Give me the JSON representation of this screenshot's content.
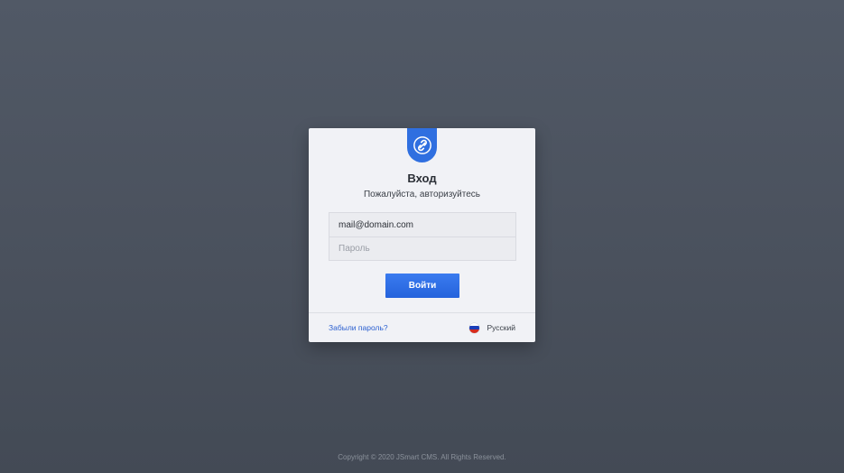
{
  "login": {
    "title": "Вход",
    "subtitle": "Пожалуйста, авторизуйтесь",
    "email_value": "mail@domain.com",
    "password_placeholder": "Пароль",
    "submit_label": "Войти",
    "forgot_label": "Забыли пароль?",
    "language_label": "Русский",
    "logo_icon": "link-icon",
    "flag_icon": "russia-flag-icon"
  },
  "footer": {
    "copyright": "Copyright © 2020 JSmart CMS. All Rights Reserved."
  },
  "colors": {
    "accent": "#2f6fe0",
    "background": "#4e5662",
    "card": "#f1f2f6",
    "link": "#2a5fd0"
  }
}
